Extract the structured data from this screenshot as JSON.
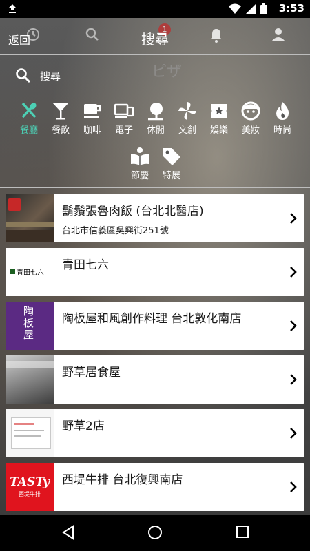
{
  "status_bar": {
    "time": "3:53"
  },
  "header": {
    "back_label": "返回",
    "title": "搜尋",
    "notification_count": "1"
  },
  "search": {
    "placeholder": "搜尋",
    "background_text": "ピザ"
  },
  "categories": [
    {
      "label": "餐廳",
      "icon": "fork-spoon-icon",
      "active": true
    },
    {
      "label": "餐飲",
      "icon": "cocktail-icon"
    },
    {
      "label": "咖啡",
      "icon": "coffee-cup-icon"
    },
    {
      "label": "電子",
      "icon": "devices-icon"
    },
    {
      "label": "休閒",
      "icon": "leisure-tree-icon"
    },
    {
      "label": "文創",
      "icon": "pinwheel-icon"
    },
    {
      "label": "娛樂",
      "icon": "ticket-star-icon"
    },
    {
      "label": "美妝",
      "icon": "face-icon"
    },
    {
      "label": "時尚",
      "icon": "flame-icon"
    },
    {
      "label": "節慶",
      "icon": "book-icon"
    },
    {
      "label": "特展",
      "icon": "tag-icon"
    }
  ],
  "results": [
    {
      "name": "鬍鬚張魯肉飯 (台北北醫店)",
      "address": "台北市信義區吳興街251號"
    },
    {
      "name": "青田七六",
      "address": "",
      "logo_text": "青田七六"
    },
    {
      "name": "陶板屋和風創作料理 台北敦化南店",
      "address": "",
      "logo_text": "陶板屋"
    },
    {
      "name": "野草居食屋",
      "address": ""
    },
    {
      "name": "野草2店",
      "address": ""
    },
    {
      "name": "西堤牛排 台北復興南店",
      "address": "",
      "logo_text": "TASTy",
      "logo_subtext": "西堤牛排"
    }
  ],
  "colors": {
    "accent": "#4dd0b5",
    "tasty_red": "#e0141e",
    "tokiya_purple": "#5b2a83"
  }
}
